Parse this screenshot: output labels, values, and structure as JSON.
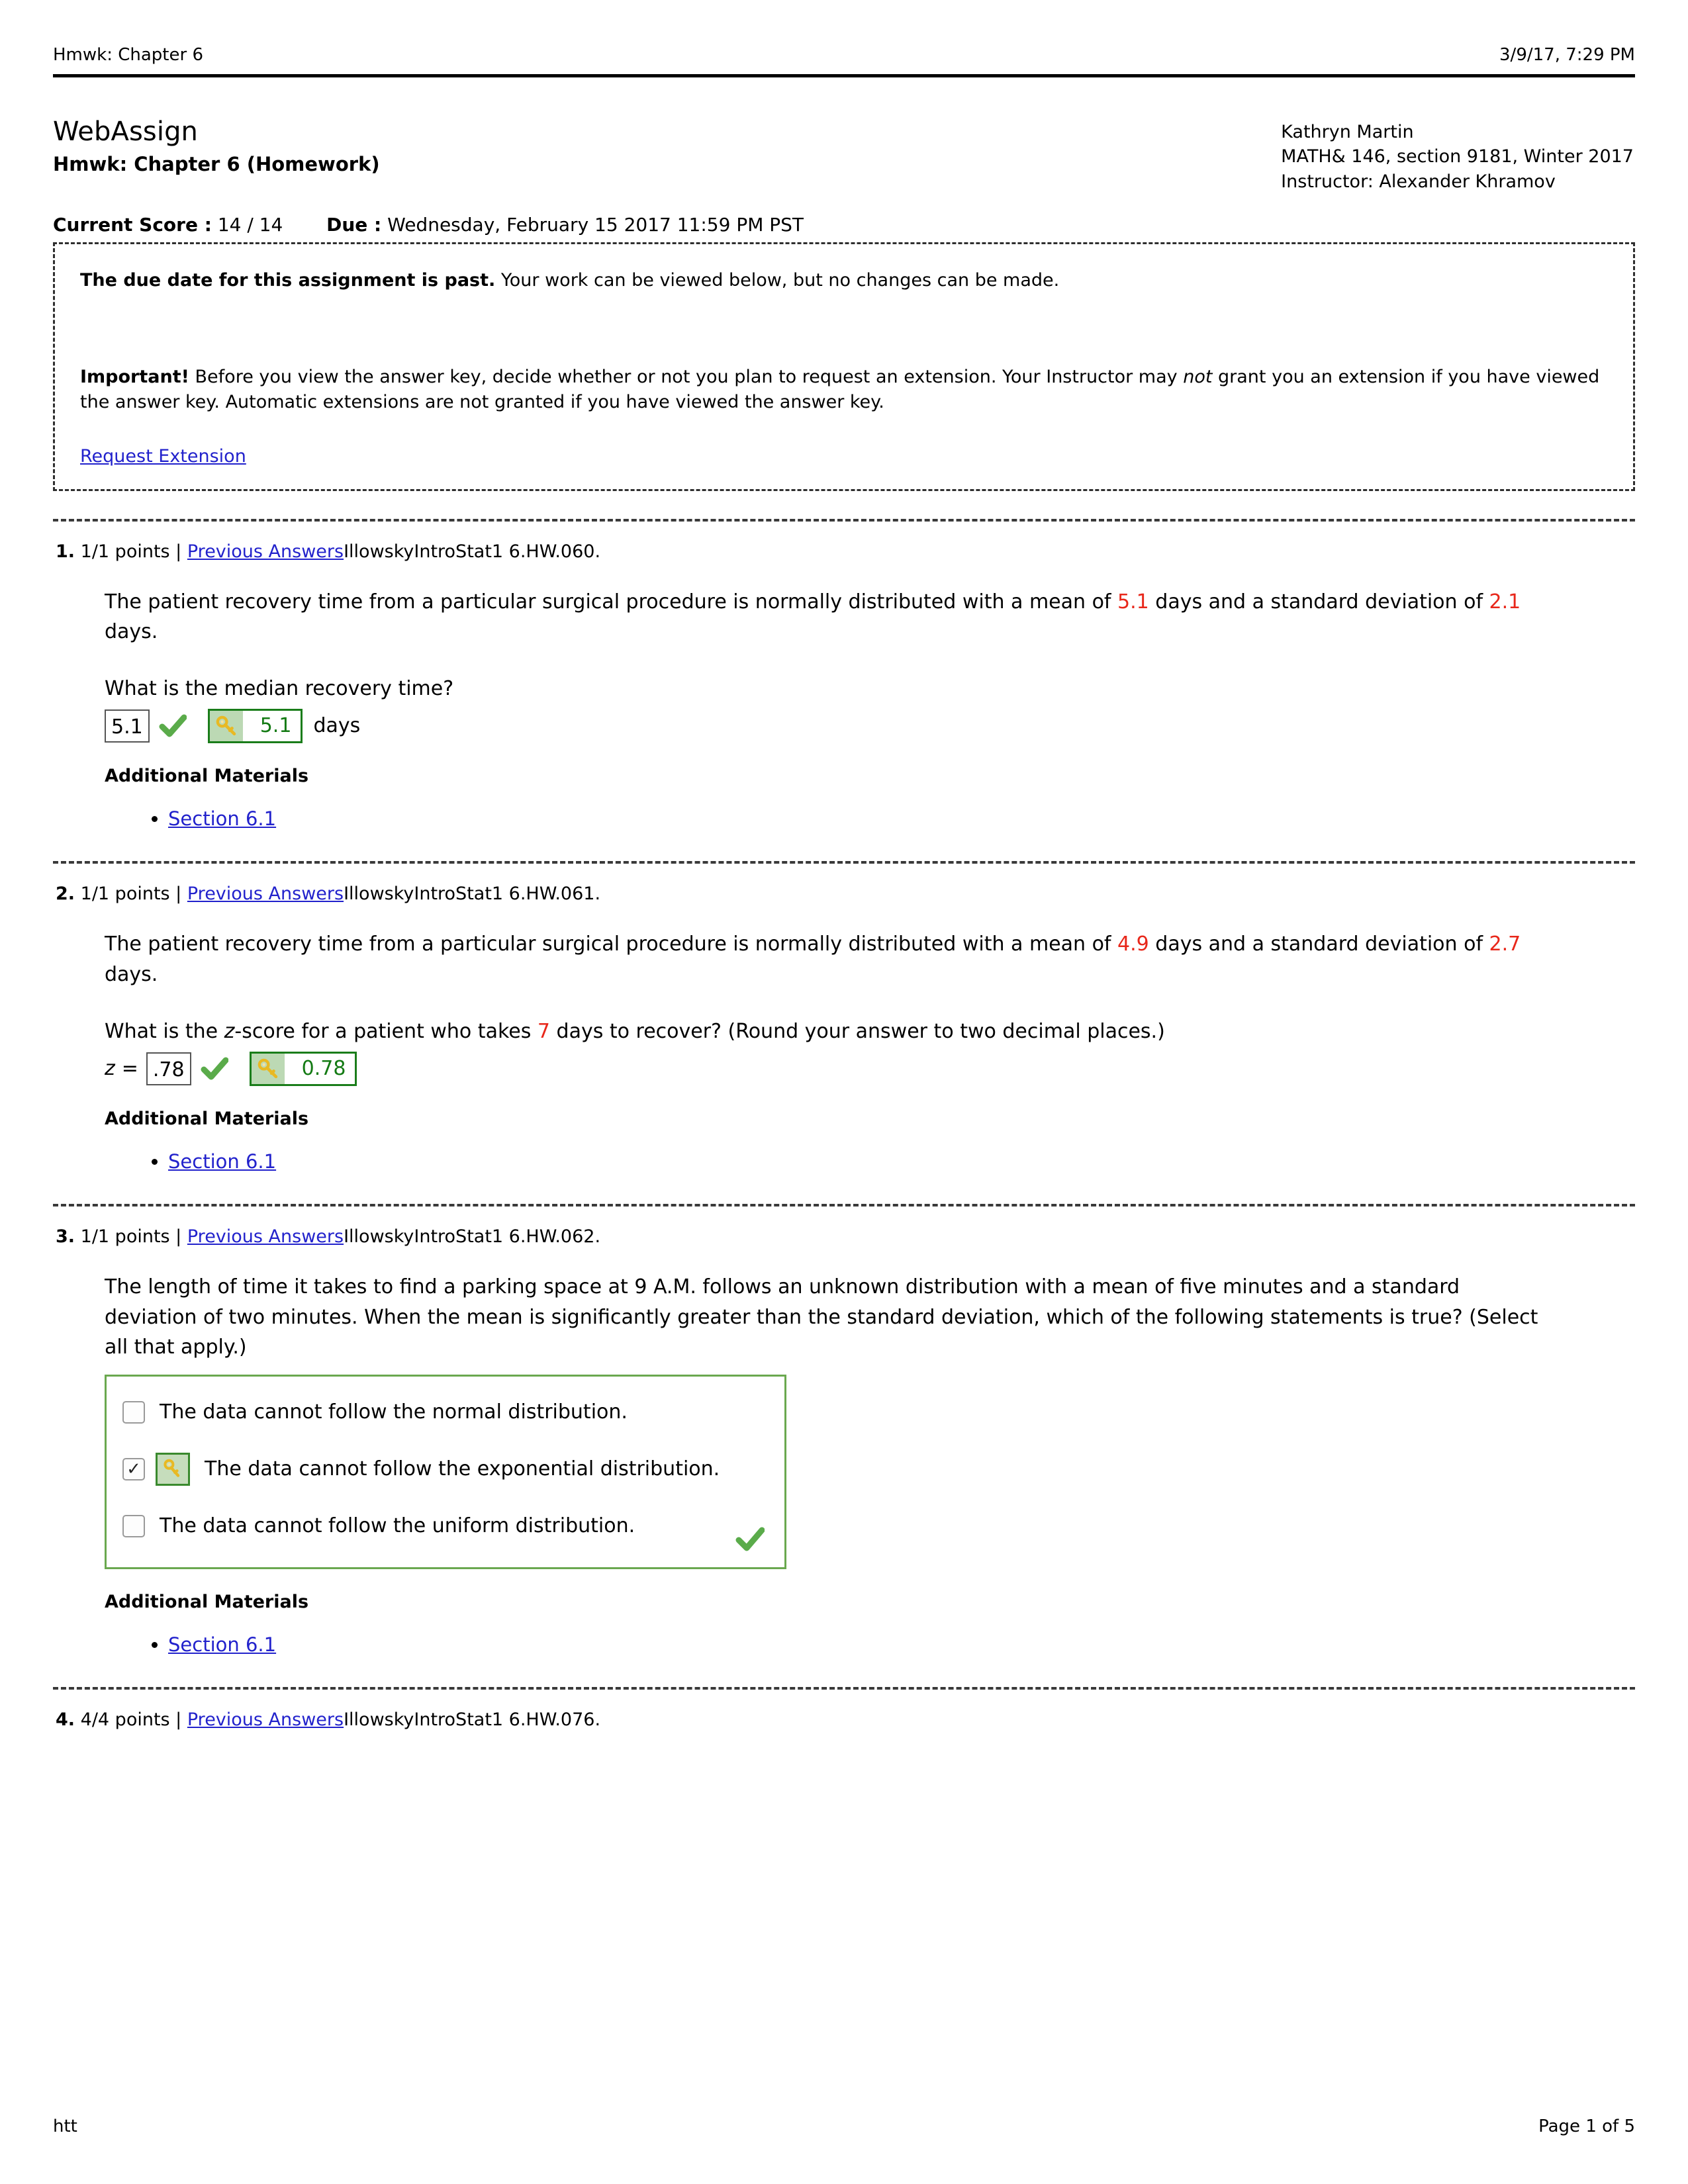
{
  "print_header": {
    "left": "Hmwk: Chapter 6",
    "right": "3/9/17, 7:29 PM"
  },
  "assignment": {
    "platform": "WebAssign",
    "title": "Hmwk: Chapter 6 (Homework)",
    "score_label": "Current Score :",
    "score_value": "14 / 14",
    "due_label": "Due :",
    "due_value": "Wednesday, February 15 2017 11:59 PM PST"
  },
  "student": {
    "name": "Kathryn Martin",
    "course": "MATH& 146, section 9181, Winter 2017",
    "instructor": "Instructor: Alexander Khramov"
  },
  "notice": {
    "past_due_bold": "The due date for this assignment is past.",
    "past_due_rest": " Your work can be viewed below, but no changes can be made.",
    "important_bold": "Important!",
    "important_part1": " Before you view the answer key, decide whether or not you plan to request an extension. Your Instructor may ",
    "important_italic": "not",
    "important_part2": " grant you an extension if you have viewed the answer key. Automatic extensions are not granted if you have viewed the answer key.",
    "request_extension_link": "Request Extension"
  },
  "questions": [
    {
      "number": "1.",
      "points": "1/1 points |",
      "previous_answers": "Previous Answers",
      "source": "IllowskyIntroStat1 6.HW.060.",
      "body_part1": "The patient recovery time from a particular surgical procedure is normally distributed with a mean of ",
      "body_value1": "5.1",
      "body_part2": " days and a standard deviation of ",
      "body_value2": "2.1",
      "body_part3": " days.",
      "prompt": "What is the median recovery time?",
      "answer_value": "5.1",
      "key_value": "5.1",
      "units": "days",
      "status_icon": "green-check-icon",
      "key_icon": "answer-key-icon",
      "additional_materials_label": "Additional Materials",
      "materials": [
        "Section 6.1"
      ]
    },
    {
      "number": "2.",
      "points": "1/1 points |",
      "previous_answers": "Previous Answers",
      "source": "IllowskyIntroStat1 6.HW.061.",
      "body_part1": "The patient recovery time from a particular surgical procedure is normally distributed with a mean of ",
      "body_value1": "4.9",
      "body_part2": " days and a standard deviation of ",
      "body_value2": "2.7",
      "body_part3": " days.",
      "prompt_part1": "What is the ",
      "prompt_italic": "z",
      "prompt_part2": "-score for a patient who takes ",
      "prompt_value": "7",
      "prompt_part3": " days to recover? (Round your answer to two decimal places.)",
      "answer_label": "z",
      "answer_eq": "=",
      "answer_value": ".78",
      "key_value": "0.78",
      "units": "",
      "status_icon": "green-check-icon",
      "key_icon": "answer-key-icon",
      "additional_materials_label": "Additional Materials",
      "materials": [
        "Section 6.1"
      ]
    },
    {
      "number": "3.",
      "points": "1/1 points |",
      "previous_answers": "Previous Answers",
      "source": "IllowskyIntroStat1 6.HW.062.",
      "body": "The length of time it takes to find a parking space at 9 A.M. follows an unknown distribution with a mean of five minutes and a standard deviation of two minutes. When the mean is significantly greater than the standard deviation, which of the following statements is true? (Select all that apply.)",
      "choices": [
        {
          "label": "The data cannot follow the normal distribution.",
          "checked": false,
          "is_key": false,
          "mark": ""
        },
        {
          "label": "The data cannot follow the exponential distribution.",
          "checked": true,
          "is_key": true,
          "mark": "✓"
        },
        {
          "label": "The data cannot follow the uniform distribution.",
          "checked": false,
          "is_key": false,
          "mark": ""
        }
      ],
      "status_icon": "green-check-icon",
      "additional_materials_label": "Additional Materials",
      "materials": [
        "Section 6.1"
      ]
    },
    {
      "number": "4.",
      "points": "4/4 points |",
      "previous_answers": "Previous Answers",
      "source": "IllowskyIntroStat1 6.HW.076."
    }
  ],
  "page_footer": {
    "left": "htt",
    "right": "Page 1 of 5"
  },
  "colors": {
    "link": "#2222cc",
    "value_red": "#e8271a",
    "key_green": "#137a13",
    "key_border": "#1a7d1a",
    "choice_border": "#6aa84f",
    "check_green": "#5aab4a"
  }
}
